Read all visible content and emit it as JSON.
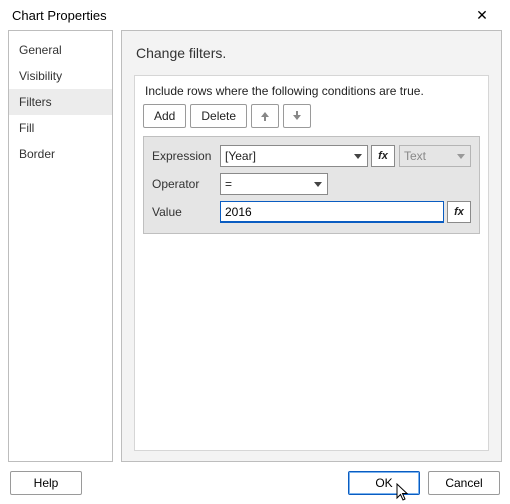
{
  "window": {
    "title": "Chart Properties",
    "close_glyph": "✕"
  },
  "sidebar": {
    "items": [
      {
        "label": "General"
      },
      {
        "label": "Visibility"
      },
      {
        "label": "Filters",
        "selected": true
      },
      {
        "label": "Fill"
      },
      {
        "label": "Border"
      }
    ]
  },
  "page": {
    "heading": "Change filters.",
    "instruction": "Include rows where the following conditions are true."
  },
  "toolbar": {
    "add_label": "Add",
    "delete_label": "Delete",
    "move_up_icon": "arrow-up-icon",
    "move_down_icon": "arrow-down-icon"
  },
  "filter": {
    "expression_label": "Expression",
    "expression_value": "[Year]",
    "fx_label": "fx",
    "type_label": "Text",
    "operator_label": "Operator",
    "operator_value": "=",
    "value_label": "Value",
    "value_value": "2016"
  },
  "footer": {
    "help_label": "Help",
    "ok_label": "OK",
    "cancel_label": "Cancel"
  }
}
